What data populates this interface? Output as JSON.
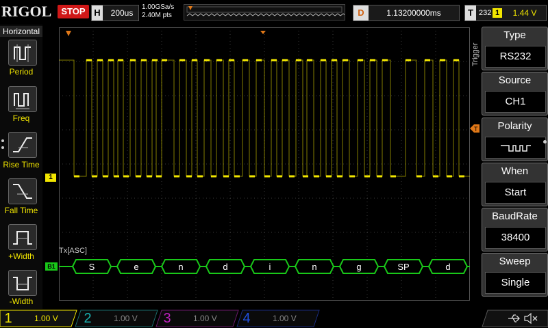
{
  "header": {
    "brand": "RIGOL",
    "run_state": "STOP",
    "horizontal": {
      "label": "H",
      "value": "200us"
    },
    "sample_rate": "1.00GSa/s",
    "mem_depth": "2.40M pts",
    "delay": {
      "label": "D",
      "value": "1.13200000ms"
    },
    "trigger": {
      "label": "T",
      "source_ch": "1",
      "level": "1.44 V",
      "type_code": "232"
    }
  },
  "left_menu": {
    "title": "Horizontal",
    "items": [
      {
        "label": "Period",
        "icon": "period-icon"
      },
      {
        "label": "Freq",
        "icon": "freq-icon"
      },
      {
        "label": "Rise Time",
        "icon": "rise-time-icon"
      },
      {
        "label": "Fall Time",
        "icon": "fall-time-icon"
      },
      {
        "label": "+Width",
        "icon": "pos-width-icon"
      },
      {
        "label": "-Width",
        "icon": "neg-width-icon"
      }
    ]
  },
  "right_menu": {
    "vertical_title": "Trigger",
    "items": [
      {
        "title": "Type",
        "value": "RS232"
      },
      {
        "title": "Source",
        "value": "CH1"
      },
      {
        "title": "Polarity",
        "value": ""
      },
      {
        "title": "When",
        "value": "Start"
      },
      {
        "title": "BaudRate",
        "value": "38400"
      },
      {
        "title": "Sweep",
        "value": "Single"
      }
    ]
  },
  "waveform": {
    "ch1_marker": "1",
    "bus_marker": "B1",
    "bus_label": "Tx[ASC]",
    "decoded": [
      "S",
      "e",
      "n",
      "d",
      "i",
      "n",
      "g",
      "SP",
      "d"
    ],
    "colors": {
      "ch1": "#f2e600",
      "bus": "#19c819",
      "trigger": "#e07818",
      "grid": "#3a3a3a"
    }
  },
  "channels": [
    {
      "num": "1",
      "scale": "1.00 V",
      "color": "#f2e600",
      "active": true
    },
    {
      "num": "2",
      "scale": "1.00 V",
      "color": "#19b0b0",
      "active": false
    },
    {
      "num": "3",
      "scale": "1.00 V",
      "color": "#c020c0",
      "active": false
    },
    {
      "num": "4",
      "scale": "1.00 V",
      "color": "#2050e0",
      "active": false
    }
  ],
  "status_icons": [
    "usb-icon",
    "speaker-muted-icon"
  ]
}
